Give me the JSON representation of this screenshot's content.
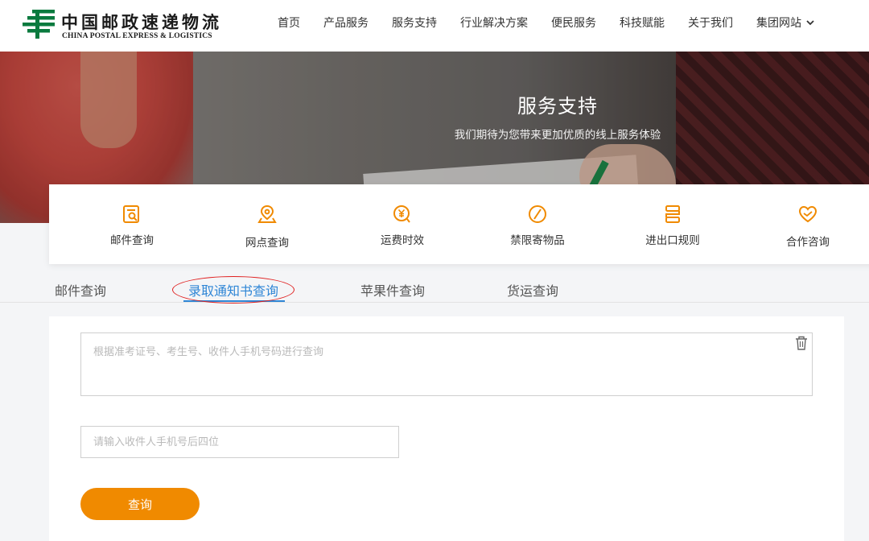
{
  "header": {
    "logo_cn": "中国邮政速递物流",
    "logo_en": "CHINA POSTAL EXPRESS & LOGISTICS",
    "brand_color": "#0a7a3e",
    "nav": [
      {
        "label": "首页"
      },
      {
        "label": "产品服务"
      },
      {
        "label": "服务支持"
      },
      {
        "label": "行业解决方案"
      },
      {
        "label": "便民服务"
      },
      {
        "label": "科技赋能"
      },
      {
        "label": "关于我们"
      },
      {
        "label": "集团网站"
      }
    ],
    "nav_dropdown_icon": "chevron-down-icon"
  },
  "banner": {
    "title": "服务支持",
    "subtitle": "我们期待为您带来更加优质的线上服务体验"
  },
  "services": [
    {
      "label": "邮件查询",
      "icon": "mail-search-icon"
    },
    {
      "label": "网点查询",
      "icon": "location-pin-icon"
    },
    {
      "label": "运费时效",
      "icon": "yuan-clock-icon"
    },
    {
      "label": "禁限寄物品",
      "icon": "prohibited-icon"
    },
    {
      "label": "进出口规则",
      "icon": "rules-icon"
    },
    {
      "label": "合作咨询",
      "icon": "handshake-heart-icon"
    }
  ],
  "service_icon_color": "#f08a00",
  "tabs": [
    {
      "label": "邮件查询",
      "active": false
    },
    {
      "label": "录取通知书查询",
      "active": true
    },
    {
      "label": "苹果件查询",
      "active": false
    },
    {
      "label": "货运查询",
      "active": false
    }
  ],
  "form": {
    "query_placeholder": "根据准考证号、考生号、收件人手机号码进行查询",
    "phone_placeholder": "请输入收件人手机号后四位",
    "submit_label": "查询",
    "clear_icon": "trash-icon"
  },
  "colors": {
    "accent_orange": "#f08a00",
    "active_tab_blue": "#2f86d6",
    "annotation_red": "#e02020"
  }
}
